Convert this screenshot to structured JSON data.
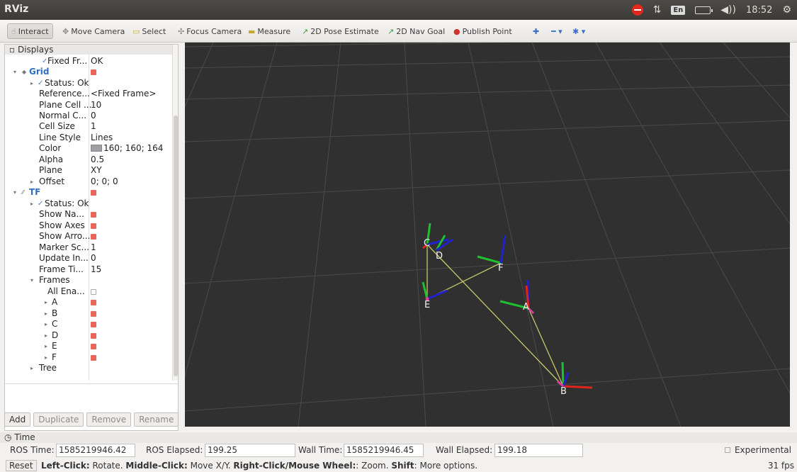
{
  "window": {
    "title": "RViz"
  },
  "system_tray": {
    "language": "En",
    "clock": "18:52"
  },
  "toolbar": {
    "interact": "Interact",
    "move_camera": "Move Camera",
    "select": "Select",
    "focus_camera": "Focus Camera",
    "measure": "Measure",
    "pose_estimate": "2D Pose Estimate",
    "nav_goal": "2D Nav Goal",
    "publish_point": "Publish Point"
  },
  "displays": {
    "header": "Displays",
    "rows": [
      {
        "key": "Fixed Fr...",
        "value": "OK"
      },
      {
        "key": "Grid"
      },
      {
        "key": "Status: Ok"
      },
      {
        "key": "Reference...",
        "value": "<Fixed Frame>"
      },
      {
        "key": "Plane Cell ...",
        "value": "10"
      },
      {
        "key": "Normal C...",
        "value": "0"
      },
      {
        "key": "Cell Size",
        "value": "1"
      },
      {
        "key": "Line Style",
        "value": "Lines"
      },
      {
        "key": "Color",
        "value": "160; 160; 164"
      },
      {
        "key": "Alpha",
        "value": "0.5"
      },
      {
        "key": "Plane",
        "value": "XY"
      },
      {
        "key": "Offset",
        "value": "0; 0; 0"
      },
      {
        "key": "TF"
      },
      {
        "key": "Status: Ok"
      },
      {
        "key": "Show Na..."
      },
      {
        "key": "Show Axes"
      },
      {
        "key": "Show Arro..."
      },
      {
        "key": "Marker Sc...",
        "value": "1"
      },
      {
        "key": "Update In...",
        "value": "0"
      },
      {
        "key": "Frame Ti...",
        "value": "15"
      },
      {
        "key": "Frames"
      },
      {
        "key": "All Ena..."
      },
      {
        "key": "A"
      },
      {
        "key": "B"
      },
      {
        "key": "C"
      },
      {
        "key": "D"
      },
      {
        "key": "E"
      },
      {
        "key": "F"
      },
      {
        "key": "Tree"
      }
    ],
    "buttons": {
      "add": "Add",
      "duplicate": "Duplicate",
      "remove": "Remove",
      "rename": "Rename"
    }
  },
  "view": {
    "frame_labels": [
      "A",
      "B",
      "C",
      "D",
      "E",
      "F"
    ]
  },
  "time": {
    "header": "Time",
    "ros_time_label": "ROS Time:",
    "ros_time": "1585219946.42",
    "ros_elapsed_label": "ROS Elapsed:",
    "ros_elapsed": "199.25",
    "wall_time_label": "Wall Time:",
    "wall_time": "1585219946.45",
    "wall_elapsed_label": "Wall Elapsed:",
    "wall_elapsed": "199.18",
    "experimental": "Experimental"
  },
  "status": {
    "reset": "Reset",
    "left_click": "Left-Click:",
    "left_click_text": " Rotate. ",
    "middle_click": "Middle-Click:",
    "middle_click_text": " Move X/Y. ",
    "right_click": "Right-Click/Mouse Wheel:",
    "right_click_text": ": Zoom. ",
    "shift": "Shift",
    "shift_text": ": More options.",
    "fps": "31 fps"
  }
}
